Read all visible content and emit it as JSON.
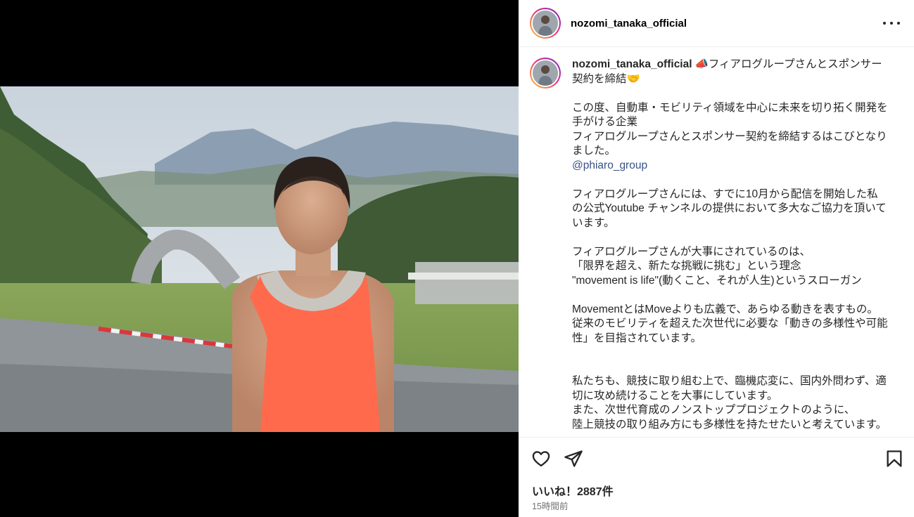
{
  "post": {
    "username": "nozomi_tanaka_official",
    "more_icon": "more-horizontal-icon",
    "image_alt": "Woman in an orange running singlet standing in front of a race course with mountains"
  },
  "caption": {
    "username": "nozomi_tanaka_official",
    "lines": [
      "📣フィアログループさんとスポンサー契約を締結🤝",
      "",
      "この度、自動車・モビリティ領域を中心に未来を切り拓く開発を手がける企業",
      "フィアログループさんとスポンサー契約を締結するはこびとなりました。",
      "@phiaro_group",
      "",
      "フィアログループさんには、すでに10月から配信を開始した私の公式Youtube チャンネルの提供において多大なご協力を頂いています。",
      "",
      "フィアログループさんが大事にされているのは、",
      "「限界を超え、新たな挑戦に挑む」という理念",
      "\"movement is life\"(動くこと、それが人生)というスローガン",
      "",
      "MovementとはMoveよりも広義で、あらゆる動きを表すもの。",
      "従来のモビリティを超えた次世代に必要な「動きの多様性や可能性」を目指されています。",
      "",
      "",
      "私たちも、競技に取り組む上で、臨機応変に、国内外問わず、適切に攻め続けることを大事にしています。",
      "また、次世代育成のノンストッププロジェクトのように、",
      "陸上競技の取り組み方にも多様性を持たせたいと考えています。"
    ]
  },
  "actions": {
    "like_icon": "heart-icon",
    "share_icon": "send-icon",
    "save_icon": "bookmark-icon",
    "likes_text": "いいね！2887件",
    "time_text": "15時間前"
  }
}
